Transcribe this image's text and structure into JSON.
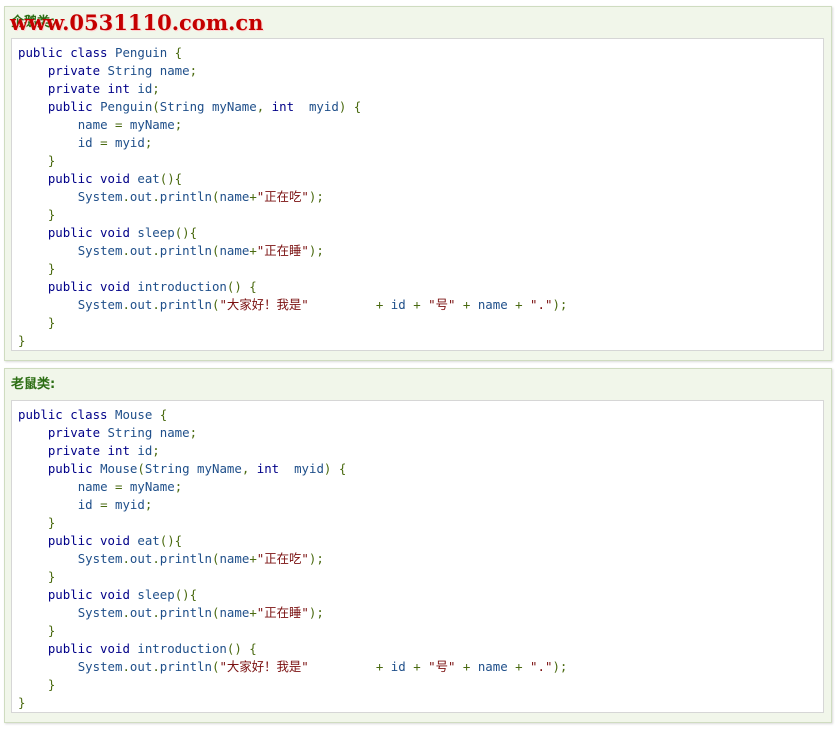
{
  "watermark": "www.0531110.com.cn",
  "colors": {
    "panel_bg": "#f1f6ea",
    "title": "#2c6e14",
    "keyword": "#000088",
    "identifier": "#1f4f8a",
    "punctuation": "#4a6a10",
    "string": "#7a1010"
  },
  "blocks": [
    {
      "title": "企鹅类:",
      "lines": [
        [
          [
            "kw",
            "public class "
          ],
          [
            "id",
            "Penguin "
          ],
          [
            "pu",
            "{"
          ]
        ],
        [
          [
            "pl",
            "    "
          ],
          [
            "kw",
            "private "
          ],
          [
            "id",
            "String name"
          ],
          [
            "pu",
            ";"
          ]
        ],
        [
          [
            "pl",
            "    "
          ],
          [
            "kw",
            "private int "
          ],
          [
            "id",
            "id"
          ],
          [
            "pu",
            ";"
          ]
        ],
        [
          [
            "pl",
            "    "
          ],
          [
            "kw",
            "public "
          ],
          [
            "id",
            "Penguin"
          ],
          [
            "pu",
            "("
          ],
          [
            "id",
            "String myName"
          ],
          [
            "pu",
            ", "
          ],
          [
            "kw",
            "int  "
          ],
          [
            "id",
            "myid"
          ],
          [
            "pu",
            ") {"
          ]
        ],
        [
          [
            "pl",
            "        "
          ],
          [
            "id",
            "name "
          ],
          [
            "pu",
            "= "
          ],
          [
            "id",
            "myName"
          ],
          [
            "pu",
            ";"
          ]
        ],
        [
          [
            "pl",
            "        "
          ],
          [
            "id",
            "id "
          ],
          [
            "pu",
            "= "
          ],
          [
            "id",
            "myid"
          ],
          [
            "pu",
            ";"
          ]
        ],
        [
          [
            "pl",
            "    "
          ],
          [
            "pu",
            "}"
          ]
        ],
        [
          [
            "pl",
            "    "
          ],
          [
            "kw",
            "public void "
          ],
          [
            "id",
            "eat"
          ],
          [
            "pu",
            "(){"
          ]
        ],
        [
          [
            "pl",
            "        "
          ],
          [
            "id",
            "System"
          ],
          [
            "pu",
            "."
          ],
          [
            "id",
            "out"
          ],
          [
            "pu",
            "."
          ],
          [
            "id",
            "println"
          ],
          [
            "pu",
            "("
          ],
          [
            "id",
            "name"
          ],
          [
            "pu",
            "+"
          ],
          [
            "st",
            "\"正在吃\""
          ],
          [
            "pu",
            ");"
          ]
        ],
        [
          [
            "pl",
            "    "
          ],
          [
            "pu",
            "}"
          ]
        ],
        [
          [
            "pl",
            "    "
          ],
          [
            "kw",
            "public void "
          ],
          [
            "id",
            "sleep"
          ],
          [
            "pu",
            "(){"
          ]
        ],
        [
          [
            "pl",
            "        "
          ],
          [
            "id",
            "System"
          ],
          [
            "pu",
            "."
          ],
          [
            "id",
            "out"
          ],
          [
            "pu",
            "."
          ],
          [
            "id",
            "println"
          ],
          [
            "pu",
            "("
          ],
          [
            "id",
            "name"
          ],
          [
            "pu",
            "+"
          ],
          [
            "st",
            "\"正在睡\""
          ],
          [
            "pu",
            ");"
          ]
        ],
        [
          [
            "pl",
            "    "
          ],
          [
            "pu",
            "}"
          ]
        ],
        [
          [
            "pl",
            "    "
          ],
          [
            "kw",
            "public void "
          ],
          [
            "id",
            "introduction"
          ],
          [
            "pu",
            "() {"
          ]
        ],
        [
          [
            "pl",
            "        "
          ],
          [
            "id",
            "System"
          ],
          [
            "pu",
            "."
          ],
          [
            "id",
            "out"
          ],
          [
            "pu",
            "."
          ],
          [
            "id",
            "println"
          ],
          [
            "pu",
            "("
          ],
          [
            "st",
            "\"大家好！我是\"         "
          ],
          [
            "pu",
            "+ "
          ],
          [
            "id",
            "id "
          ],
          [
            "pu",
            "+ "
          ],
          [
            "st",
            "\"号\" "
          ],
          [
            "pu",
            "+ "
          ],
          [
            "id",
            "name "
          ],
          [
            "pu",
            "+ "
          ],
          [
            "st",
            "\".\""
          ],
          [
            "pu",
            ");"
          ]
        ],
        [
          [
            "pl",
            "    "
          ],
          [
            "pu",
            "}"
          ]
        ],
        [
          [
            "pu",
            "}"
          ]
        ]
      ]
    },
    {
      "title": "老鼠类:",
      "lines": [
        [
          [
            "kw",
            "public class "
          ],
          [
            "id",
            "Mouse "
          ],
          [
            "pu",
            "{"
          ]
        ],
        [
          [
            "pl",
            "    "
          ],
          [
            "kw",
            "private "
          ],
          [
            "id",
            "String name"
          ],
          [
            "pu",
            ";"
          ]
        ],
        [
          [
            "pl",
            "    "
          ],
          [
            "kw",
            "private int "
          ],
          [
            "id",
            "id"
          ],
          [
            "pu",
            ";"
          ]
        ],
        [
          [
            "pl",
            "    "
          ],
          [
            "kw",
            "public "
          ],
          [
            "id",
            "Mouse"
          ],
          [
            "pu",
            "("
          ],
          [
            "id",
            "String myName"
          ],
          [
            "pu",
            ", "
          ],
          [
            "kw",
            "int  "
          ],
          [
            "id",
            "myid"
          ],
          [
            "pu",
            ") {"
          ]
        ],
        [
          [
            "pl",
            "        "
          ],
          [
            "id",
            "name "
          ],
          [
            "pu",
            "= "
          ],
          [
            "id",
            "myName"
          ],
          [
            "pu",
            ";"
          ]
        ],
        [
          [
            "pl",
            "        "
          ],
          [
            "id",
            "id "
          ],
          [
            "pu",
            "= "
          ],
          [
            "id",
            "myid"
          ],
          [
            "pu",
            ";"
          ]
        ],
        [
          [
            "pl",
            "    "
          ],
          [
            "pu",
            "}"
          ]
        ],
        [
          [
            "pl",
            "    "
          ],
          [
            "kw",
            "public void "
          ],
          [
            "id",
            "eat"
          ],
          [
            "pu",
            "(){"
          ]
        ],
        [
          [
            "pl",
            "        "
          ],
          [
            "id",
            "System"
          ],
          [
            "pu",
            "."
          ],
          [
            "id",
            "out"
          ],
          [
            "pu",
            "."
          ],
          [
            "id",
            "println"
          ],
          [
            "pu",
            "("
          ],
          [
            "id",
            "name"
          ],
          [
            "pu",
            "+"
          ],
          [
            "st",
            "\"正在吃\""
          ],
          [
            "pu",
            ");"
          ]
        ],
        [
          [
            "pl",
            "    "
          ],
          [
            "pu",
            "}"
          ]
        ],
        [
          [
            "pl",
            "    "
          ],
          [
            "kw",
            "public void "
          ],
          [
            "id",
            "sleep"
          ],
          [
            "pu",
            "(){"
          ]
        ],
        [
          [
            "pl",
            "        "
          ],
          [
            "id",
            "System"
          ],
          [
            "pu",
            "."
          ],
          [
            "id",
            "out"
          ],
          [
            "pu",
            "."
          ],
          [
            "id",
            "println"
          ],
          [
            "pu",
            "("
          ],
          [
            "id",
            "name"
          ],
          [
            "pu",
            "+"
          ],
          [
            "st",
            "\"正在睡\""
          ],
          [
            "pu",
            ");"
          ]
        ],
        [
          [
            "pl",
            "    "
          ],
          [
            "pu",
            "}"
          ]
        ],
        [
          [
            "pl",
            "    "
          ],
          [
            "kw",
            "public void "
          ],
          [
            "id",
            "introduction"
          ],
          [
            "pu",
            "() {"
          ]
        ],
        [
          [
            "pl",
            "        "
          ],
          [
            "id",
            "System"
          ],
          [
            "pu",
            "."
          ],
          [
            "id",
            "out"
          ],
          [
            "pu",
            "."
          ],
          [
            "id",
            "println"
          ],
          [
            "pu",
            "("
          ],
          [
            "st",
            "\"大家好！我是\"         "
          ],
          [
            "pu",
            "+ "
          ],
          [
            "id",
            "id "
          ],
          [
            "pu",
            "+ "
          ],
          [
            "st",
            "\"号\" "
          ],
          [
            "pu",
            "+ "
          ],
          [
            "id",
            "name "
          ],
          [
            "pu",
            "+ "
          ],
          [
            "st",
            "\".\""
          ],
          [
            "pu",
            ");"
          ]
        ],
        [
          [
            "pl",
            "    "
          ],
          [
            "pu",
            "}"
          ]
        ],
        [
          [
            "pu",
            "}"
          ]
        ]
      ]
    }
  ]
}
